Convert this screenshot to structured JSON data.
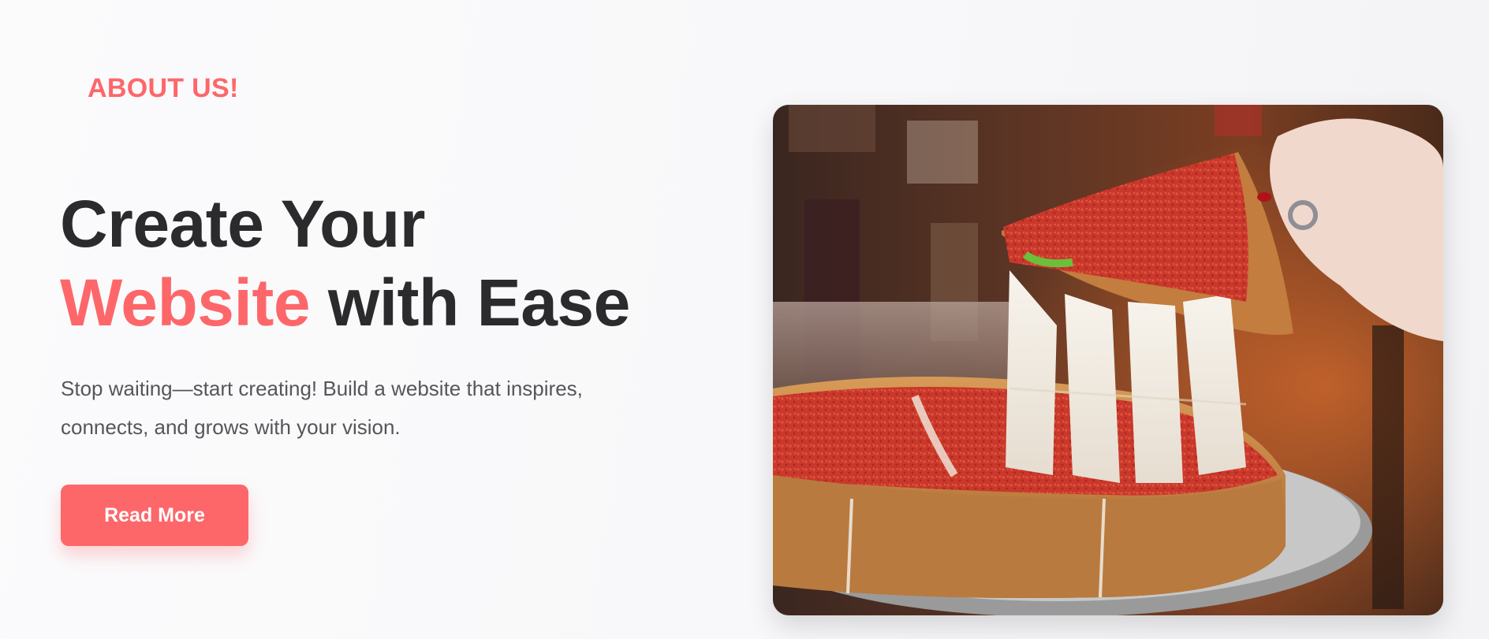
{
  "section": {
    "eyebrow": "ABOUT US!",
    "headline": {
      "line1": "Create Your",
      "accent": "Website",
      "line2_rest": " with Ease"
    },
    "description": "Stop waiting—start creating! Build a website that inspires, connects, and grows with your vision.",
    "cta_label": "Read More"
  },
  "image": {
    "subject": "deep-dish pizza slice being lifted with stretching cheese"
  },
  "colors": {
    "accent": "#fd676a",
    "heading": "#2b2b2d",
    "body_text": "#55565a",
    "background": "#f9f9fb"
  }
}
